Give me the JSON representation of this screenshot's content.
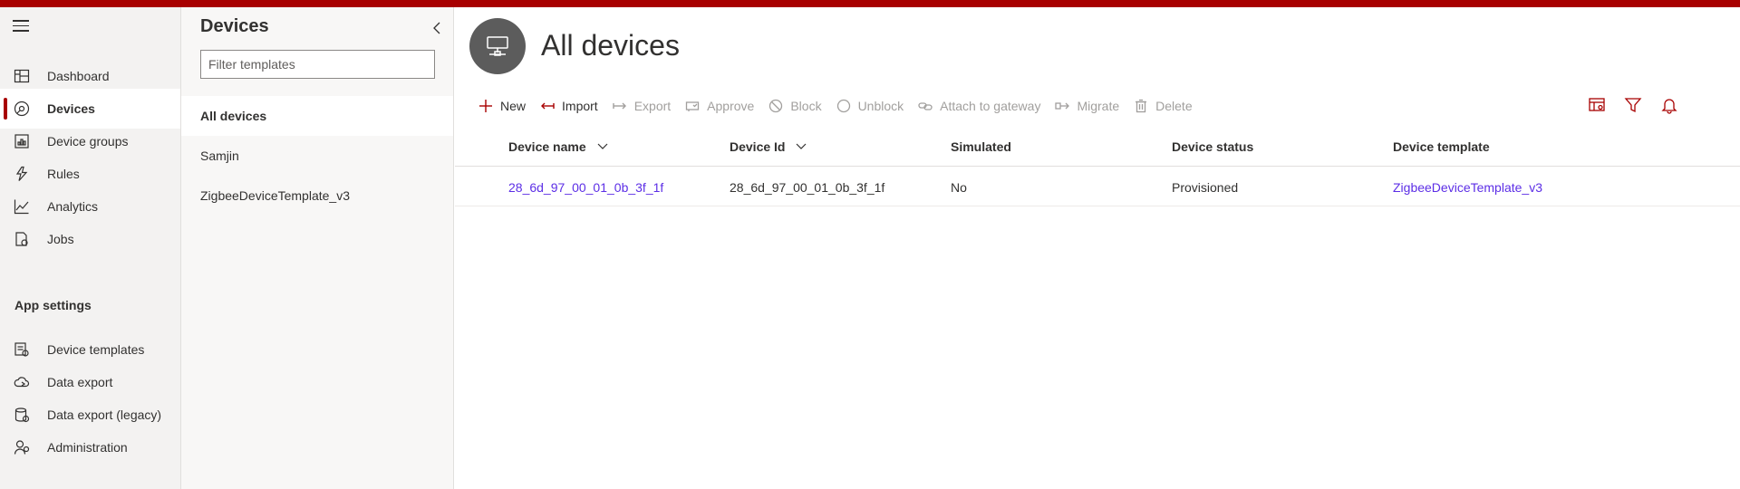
{
  "leftnav": {
    "items": [
      {
        "label": "Dashboard",
        "icon": "dashboard-icon"
      },
      {
        "label": "Devices",
        "icon": "devices-icon",
        "active": true
      },
      {
        "label": "Device groups",
        "icon": "device-groups-icon"
      },
      {
        "label": "Rules",
        "icon": "rules-icon"
      },
      {
        "label": "Analytics",
        "icon": "analytics-icon"
      },
      {
        "label": "Jobs",
        "icon": "jobs-icon"
      }
    ],
    "section_label": "App settings",
    "settings_items": [
      {
        "label": "Device templates",
        "icon": "device-templates-icon"
      },
      {
        "label": "Data export",
        "icon": "data-export-icon"
      },
      {
        "label": "Data export (legacy)",
        "icon": "data-export-legacy-icon"
      },
      {
        "label": "Administration",
        "icon": "administration-icon"
      }
    ]
  },
  "templates": {
    "title": "Devices",
    "filter_placeholder": "Filter templates",
    "items": [
      "All devices",
      "Samjin",
      "ZigbeeDeviceTemplate_v3"
    ]
  },
  "main": {
    "title": "All devices",
    "toolbar": {
      "new": "New",
      "import": "Import",
      "export": "Export",
      "approve": "Approve",
      "block": "Block",
      "unblock": "Unblock",
      "attach": "Attach to gateway",
      "migrate": "Migrate",
      "delete": "Delete"
    },
    "columns": [
      "Device name",
      "Device Id",
      "Simulated",
      "Device status",
      "Device template"
    ],
    "rows": [
      {
        "device_name": "28_6d_97_00_01_0b_3f_1f",
        "device_id": "28_6d_97_00_01_0b_3f_1f",
        "simulated": "No",
        "status": "Provisioned",
        "template": "ZigbeeDeviceTemplate_v3"
      }
    ]
  },
  "colors": {
    "brand": "#a80000",
    "link": "#5c2ee6",
    "disabled": "#a19f9d"
  }
}
